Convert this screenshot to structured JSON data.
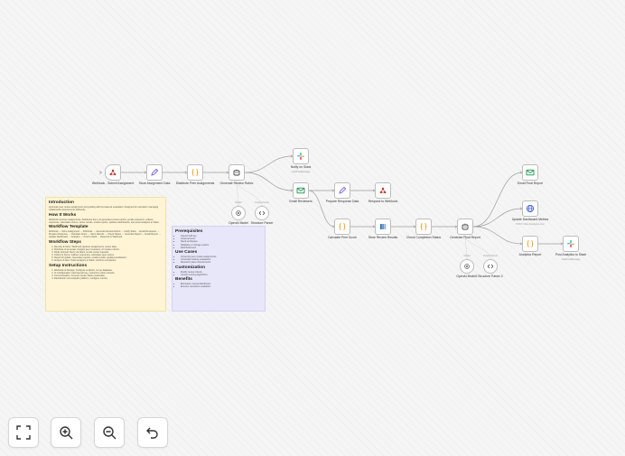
{
  "canvas": {
    "nodes": {
      "webhook": {
        "label": "Webhook - Submit Assignment",
        "icon": "webhook-icon"
      },
      "store_assignment": {
        "label": "Store Assignment Data",
        "icon": "pencil-icon"
      },
      "distribute_peer": {
        "label": "Distribute Peer Assignments",
        "icon": "code-braces-icon"
      },
      "generate_rubric": {
        "label": "Generate Review Rubric",
        "icon": "robot-icon"
      },
      "notify_slack": {
        "label": "Notify on Slack",
        "sub": "chatPostMessage",
        "icon": "slack-icon"
      },
      "email_reviewers": {
        "label": "Email Reviewers",
        "icon": "email-icon"
      },
      "prepare_response": {
        "label": "Prepare Response Data",
        "icon": "pencil-icon"
      },
      "respond_webhook": {
        "label": "Respond to Webhook",
        "icon": "webhook-icon"
      },
      "openai_model": {
        "label": "OpenAI Model",
        "tag": "Model",
        "icon": "openai-icon"
      },
      "structure_parser": {
        "label": "Structure Parser",
        "tag": "Output Parser",
        "icon": "code-icon"
      },
      "calculate_peer": {
        "label": "Calculate Peer Score",
        "icon": "code-braces-icon"
      },
      "store_review": {
        "label": "Store Review Results",
        "icon": "database-icon"
      },
      "check_completion": {
        "label": "Check Completion Status",
        "icon": "code-braces-icon"
      },
      "generate_final": {
        "label": "Generate Final Report",
        "icon": "robot-icon"
      },
      "email_final": {
        "label": "Email Final Report",
        "icon": "email-icon"
      },
      "update_dashboard": {
        "label": "Update Dashboard Metrics",
        "sub": "POST: https://analytics.com",
        "icon": "globe-icon"
      },
      "analytics_report": {
        "label": "Analytics Report",
        "icon": "code-braces-icon"
      },
      "post_analytics": {
        "label": "Post Analytics to Slack",
        "sub": "chatPostMessage",
        "icon": "slack-icon"
      },
      "openai_model2": {
        "label": "OpenAI Model1",
        "tag": "Model",
        "icon": "openai-icon"
      },
      "structure_parser2": {
        "label": "Structure Parser 2",
        "tag": "Output Parser",
        "icon": "code-icon"
      }
    },
    "edge_label": "",
    "colors": {
      "edge": "#9e9e9e",
      "slack": "#e01e5a",
      "email": "#2e9e5b",
      "pencil": "#6c5ce7",
      "code": "#f0a020",
      "robot": "#444444",
      "webhook": "#c0392b",
      "database": "#2f6fb3",
      "globe": "#3b5bdb"
    }
  },
  "note_main": {
    "intro_title": "Introduction",
    "intro_text": "Automate peer review assignment and grading with AI-powered evaluation. Designed for educators managing collaborative assessments efficiently.",
    "how_title": "How It Works",
    "how_text": "Webhook receives assignments, distributes them, AI generates review rubrics, emails reviewers, collects responses, calculates scores, stores results, emails reports, updates dashboards, and posts analytics to Slack.",
    "template_title": "Workflow Template",
    "template_text": "Webhook → Store Assignment → Distribute → Generate Review Rubric → Notify Slack → Email Reviewers → Prepare Response → Calculate Score → Store Results → Check Status → Generate Report → Email Report → Update Dashboard → Analytics → Post to Slack → Respond to Webhook",
    "steps_title": "Workflow Steps",
    "steps": [
      "Receive & Store: Webhook captures assignments, stores data.",
      "Distribute & Generate: Assigns peer reviewers, AI creates rubrics.",
      "Notify & Email: Alerts via Slack, sends review requests.",
      "Collect & Score: Gathers responses, calculates peer scores.",
      "Report & Update: Generates reports, emails results, updates dashboard.",
      "Analyze & Alert: Posts analytics to Slack, confirms completion."
    ],
    "setup_title": "Setup Instructions",
    "setup": [
      "Webhook & Storage: Configure endpoint, set up database.",
      "AI Configuration: Add OpenAI key, customize rubric prompts.",
      "Communication: Connect Gmail, Slack credentials.",
      "Dashboard: Link analytics platform, configure metrics."
    ]
  },
  "note_side": {
    "prereq_title": "Prerequisites",
    "prereq": [
      "OpenAI API key",
      "Gmail account",
      "Slack workspace",
      "Database or storage system",
      "Dashboard tool"
    ],
    "usecases_title": "Use Cases",
    "usecases": [
      "University peer review assignments",
      "Corporate training evaluations",
      "Research paper assessments"
    ],
    "custom_title": "Customization",
    "custom": [
      "Modify review criteria",
      "Custom scoring algorithms"
    ],
    "benefits_title": "Benefits",
    "benefits": [
      "Eliminates manual distribution",
      "Ensures consistent evaluation"
    ]
  },
  "controls": {
    "fit": "fit-view-icon",
    "zoom_in": "zoom-in-icon",
    "zoom_out": "zoom-out-icon",
    "undo": "undo-icon"
  }
}
